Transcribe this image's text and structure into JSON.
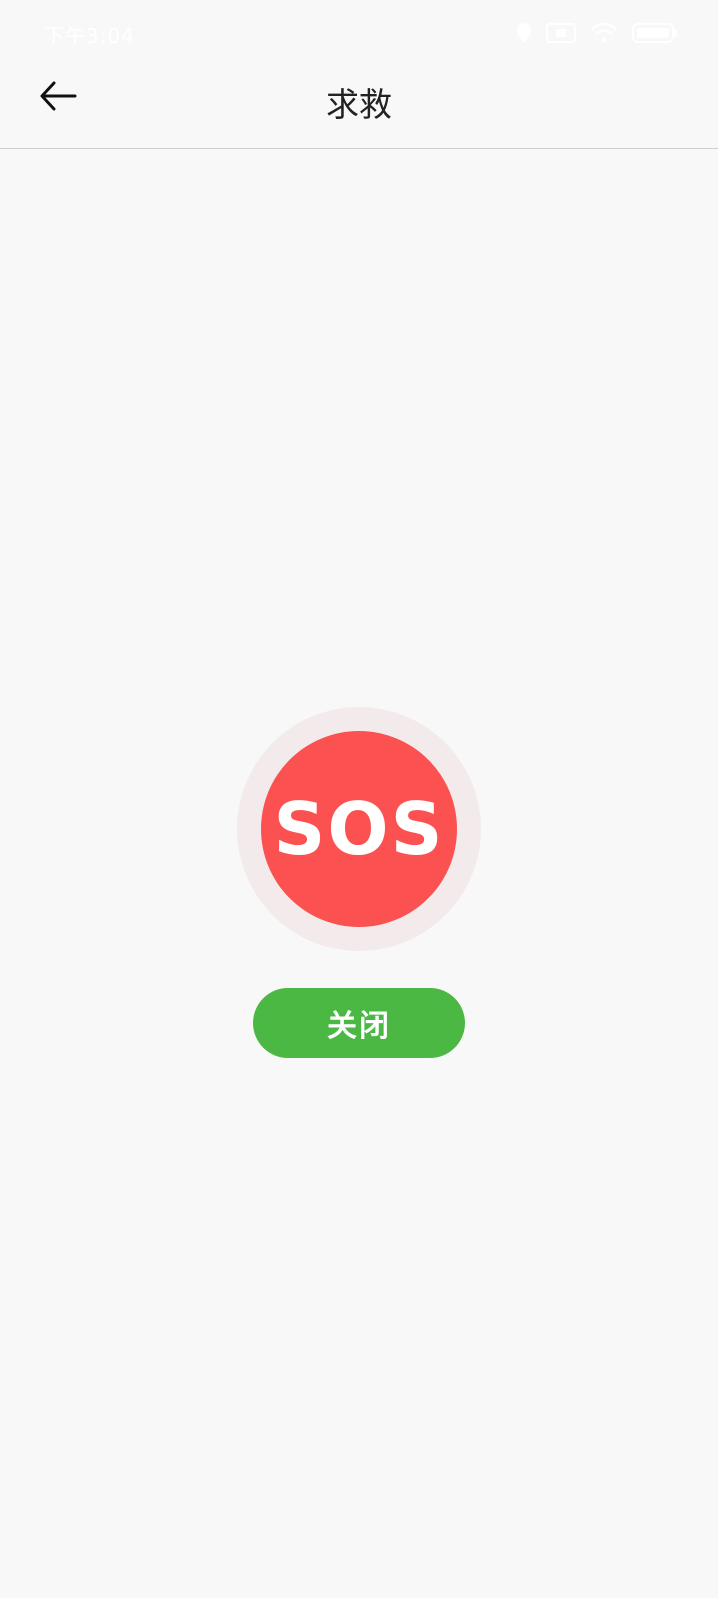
{
  "status_bar": {
    "time": "下午3:04",
    "icons": [
      "location-icon",
      "sim-icon",
      "wifi-icon",
      "battery-icon"
    ]
  },
  "header": {
    "back_icon": "arrow-left-icon",
    "title": "求救"
  },
  "main": {
    "sos_label": "SOS",
    "close_label": "关闭"
  },
  "colors": {
    "background": "#f8f8f8",
    "sos_red": "#fb5151",
    "sos_halo": "#f3ebeb",
    "close_green": "#4bb844"
  }
}
